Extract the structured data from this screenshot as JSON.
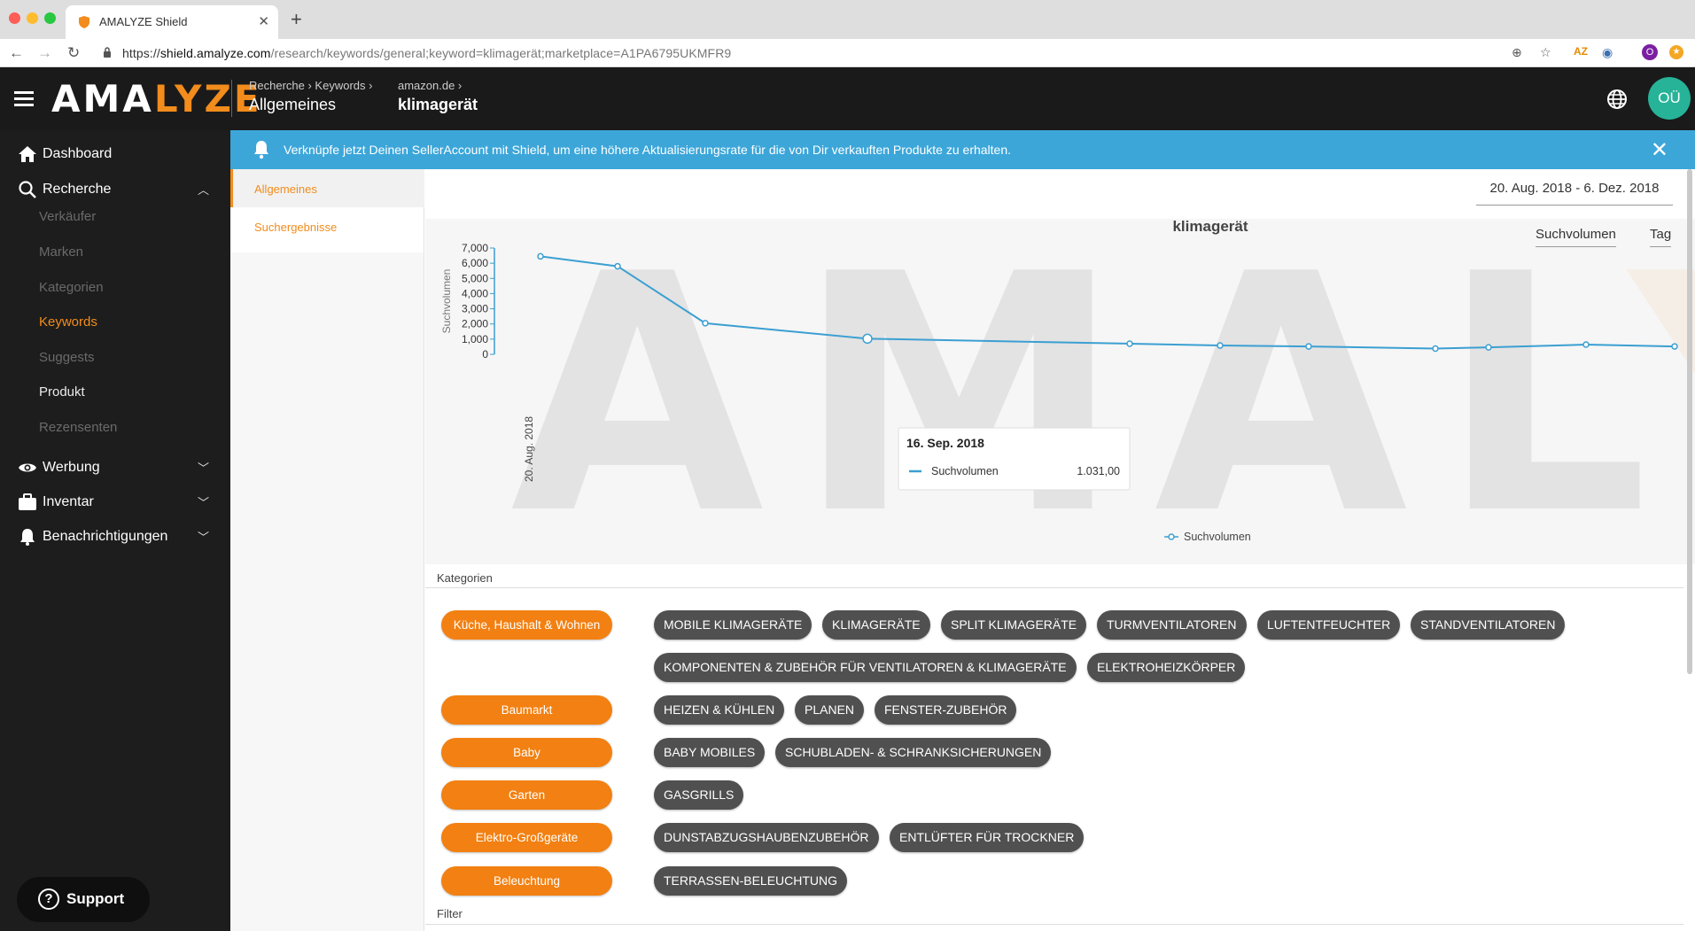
{
  "browser": {
    "tab_title": "AMALYZE Shield",
    "url_prefix": "https://",
    "url_host": "shield.amalyze.com",
    "url_path": "/research/keywords/general;keyword=klimagerät;marketplace=A1PA6795UKMFR9"
  },
  "header": {
    "logo_part1": "AMA",
    "logo_part2": "LYZE",
    "crumb1_small": "Recherche › Keywords ›",
    "crumb1_main": "Allgemeines",
    "crumb2_small": "amazon.de ›",
    "crumb2_main": "klimagerät",
    "avatar_initials": "OÜ"
  },
  "sidebar": {
    "dashboard": "Dashboard",
    "recherche": "Recherche",
    "sub": [
      "Verkäufer",
      "Marken",
      "Kategorien",
      "Keywords",
      "Suggests",
      "Produkt",
      "Rezensenten"
    ],
    "werbung": "Werbung",
    "inventar": "Inventar",
    "benachrichtigungen": "Benachrichtigungen",
    "support": "Support"
  },
  "banner": {
    "text": "Verknüpfe jetzt Deinen SellerAccount mit Shield, um eine höhere Aktualisierungsrate für die von Dir verkauften Produkte zu erhalten."
  },
  "subnav": {
    "items": [
      "Allgemeines",
      "Suchergebnisse"
    ]
  },
  "main": {
    "date_range": "20. Aug. 2018 - 6. Dez. 2018",
    "metric_select": "Suchvolumen",
    "interval_select": "Tag",
    "watermark": "AMALYZ",
    "categories_label": "Kategorien",
    "filter_label": "Filter"
  },
  "chart_data": {
    "type": "line",
    "title": "klimagerät",
    "ylabel": "Suchvolumen",
    "xlabel": "",
    "x_tick_label": "20. Aug. 2018",
    "ylim": [
      0,
      7000
    ],
    "y_ticks": [
      "0",
      "1,000",
      "2,000",
      "3,000",
      "4,000",
      "5,000",
      "6,000",
      "7,000"
    ],
    "series": [
      {
        "name": "Suchvolumen",
        "color": "#3b9fd2",
        "points": [
          {
            "x": "20. Aug. 2018",
            "y": 6450
          },
          {
            "y": 5800
          },
          {
            "y": 2050
          },
          {
            "x": "16. Sep. 2018",
            "y": 1031
          },
          {
            "y": 700
          },
          {
            "y": 580
          },
          {
            "y": 520
          },
          {
            "y": 380
          },
          {
            "y": 460
          },
          {
            "y": 640
          },
          {
            "y": 520
          }
        ]
      }
    ],
    "tooltip": {
      "date": "16. Sep. 2018",
      "series": "Suchvolumen",
      "value": "1.031,00"
    },
    "legend_position": "bottom"
  },
  "categories": [
    {
      "name": "Küche, Haushalt & Wohnen",
      "subs": [
        "MOBILE KLIMAGERÄTE",
        "KLIMAGERÄTE",
        "SPLIT KLIMAGERÄTE",
        "TURMVENTILATOREN",
        "LUFTENTFEUCHTER",
        "STANDVENTILATOREN",
        "KOMPONENTEN & ZUBEHÖR FÜR VENTILATOREN & KLIMAGERÄTE",
        "ELEKTROHEIZKÖRPER"
      ]
    },
    {
      "name": "Baumarkt",
      "subs": [
        "HEIZEN & KÜHLEN",
        "PLANEN",
        "FENSTER-ZUBEHÖR"
      ]
    },
    {
      "name": "Baby",
      "subs": [
        "BABY MOBILES",
        "SCHUBLADEN- & SCHRANKSICHERUNGEN"
      ]
    },
    {
      "name": "Garten",
      "subs": [
        "GASGRILLS"
      ]
    },
    {
      "name": "Elektro-Großgeräte",
      "subs": [
        "DUNSTABZUGSHAUBENZUBEHÖR",
        "ENTLÜFTER FÜR TROCKNER"
      ]
    },
    {
      "name": "Beleuchtung",
      "subs": [
        "TERRASSEN-BELEUCHTUNG"
      ]
    }
  ]
}
